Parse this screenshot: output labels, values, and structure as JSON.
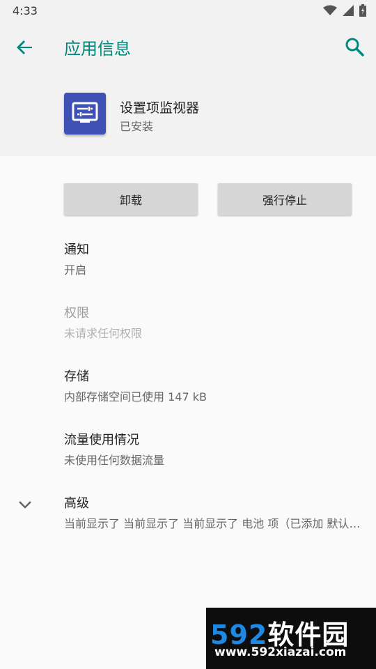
{
  "statusbar": {
    "time": "4:33",
    "icons": [
      "wifi-icon",
      "signal-icon",
      "battery-icon"
    ]
  },
  "appbar": {
    "title": "应用信息",
    "back_icon": "arrow-left-icon",
    "search_icon": "search-icon",
    "accent_color": "#00897b"
  },
  "app": {
    "name": "设置项监视器",
    "status": "已安装",
    "icon": "monitor-icon",
    "icon_color": "#3f51b5"
  },
  "buttons": {
    "uninstall": "卸载",
    "force_stop": "强行停止"
  },
  "prefs": {
    "notifications": {
      "title": "通知",
      "summary": "开启"
    },
    "permissions": {
      "title": "权限",
      "summary": "未请求任何权限"
    },
    "storage": {
      "title": "存储",
      "summary": "内部存储空间已使用 147 kB"
    },
    "data_usage": {
      "title": "流量使用情况",
      "summary": "未使用任何数据流量"
    },
    "advanced": {
      "title": "高级",
      "summary": "当前显示了 当前显示了 当前显示了 电池 项（已添加 默认打开）",
      "icon": "chevron-down-icon"
    }
  },
  "watermark": {
    "logo_num": "592",
    "logo_text": "软件园",
    "url": "www.592xiazai.com"
  }
}
